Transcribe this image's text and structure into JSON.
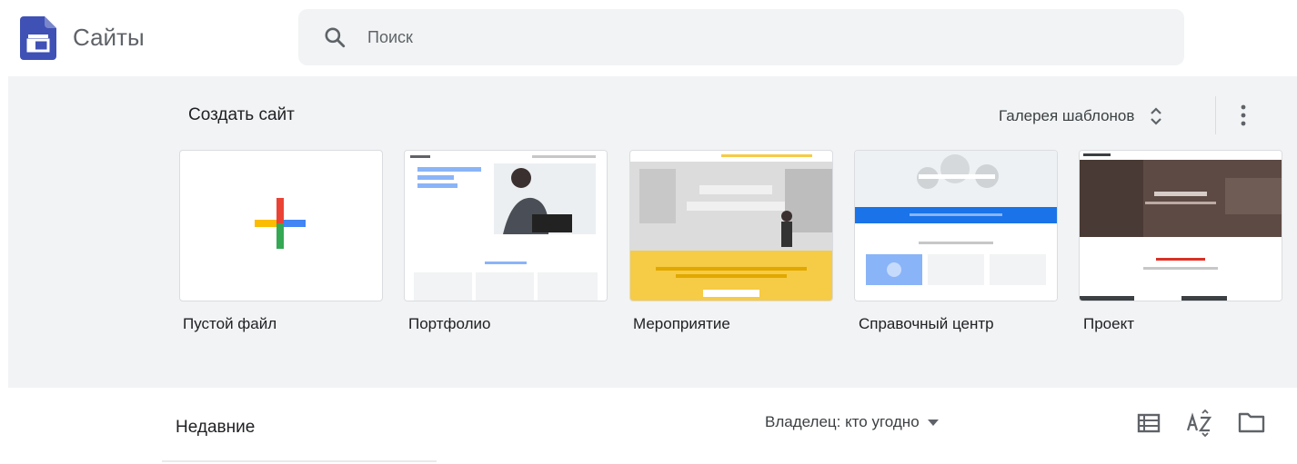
{
  "header": {
    "app_title": "Сайты",
    "search_placeholder": "Поиск"
  },
  "gallery": {
    "create_title": "Создать сайт",
    "toggle_label": "Галерея шаблонов",
    "templates": [
      {
        "label": "Пустой файл"
      },
      {
        "label": "Портфолио"
      },
      {
        "label": "Мероприятие"
      },
      {
        "label": "Справочный центр"
      },
      {
        "label": "Проект"
      }
    ]
  },
  "recent": {
    "title": "Недавние",
    "owner_filter": "Владелец: кто угодно"
  },
  "colors": {
    "brand": "#3f51b5",
    "gallery_bg": "#f1f3f4",
    "event_yellow": "#f6cb45",
    "help_blue": "#1a73e8"
  },
  "icons": [
    "sites-logo-icon",
    "search-icon",
    "unfold-icon",
    "more-vert-icon",
    "plus-icon",
    "dropdown-icon",
    "list-view-icon",
    "sort-az-icon",
    "folder-icon"
  ]
}
